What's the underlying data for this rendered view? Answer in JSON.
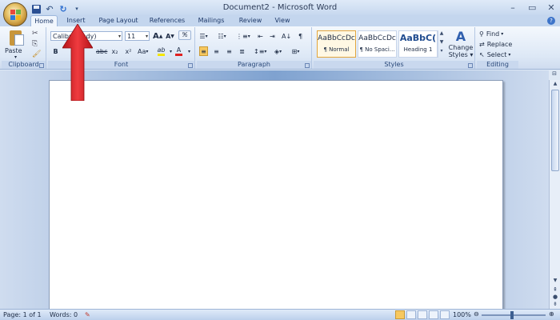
{
  "window": {
    "title": "Document2 - Microsoft Word"
  },
  "quick_access": {
    "more_glyph": "▾"
  },
  "tabs": [
    {
      "label": "Home",
      "active": true
    },
    {
      "label": "Insert",
      "active": false
    },
    {
      "label": "Page Layout",
      "active": false
    },
    {
      "label": "References",
      "active": false
    },
    {
      "label": "Mailings",
      "active": false
    },
    {
      "label": "Review",
      "active": false
    },
    {
      "label": "View",
      "active": false
    }
  ],
  "clipboard": {
    "paste_label": "Paste",
    "group_label": "Clipboard"
  },
  "font": {
    "font_name": "Calibri (Body)",
    "font_size": "11",
    "grow": "A",
    "shrink": "A",
    "bold": "B",
    "strike": "abc",
    "subscript": "x₂",
    "superscript": "x²",
    "change_case": "Aa",
    "highlight": "ab",
    "font_color": "A",
    "group_label": "Font"
  },
  "paragraph": {
    "group_label": "Paragraph",
    "show_marks": "¶"
  },
  "styles": {
    "tiles": [
      {
        "sample": "AaBbCcDc",
        "name": "¶ Normal",
        "active": true
      },
      {
        "sample": "AaBbCcDc",
        "name": "¶ No Spaci...",
        "active": false
      },
      {
        "sample": "AaBbC(",
        "name": "Heading 1",
        "active": false
      }
    ],
    "change_styles_line1": "Change",
    "change_styles_line2": "Styles",
    "group_label": "Styles"
  },
  "editing": {
    "find": "Find",
    "replace": "Replace",
    "select": "Select",
    "group_label": "Editing"
  },
  "status": {
    "page": "Page: 1 of 1",
    "words": "Words: 0",
    "zoom": "100%"
  },
  "colors": {
    "highlight": "#f5e600",
    "font_color": "#e02020",
    "arrow": "#e3262a"
  }
}
